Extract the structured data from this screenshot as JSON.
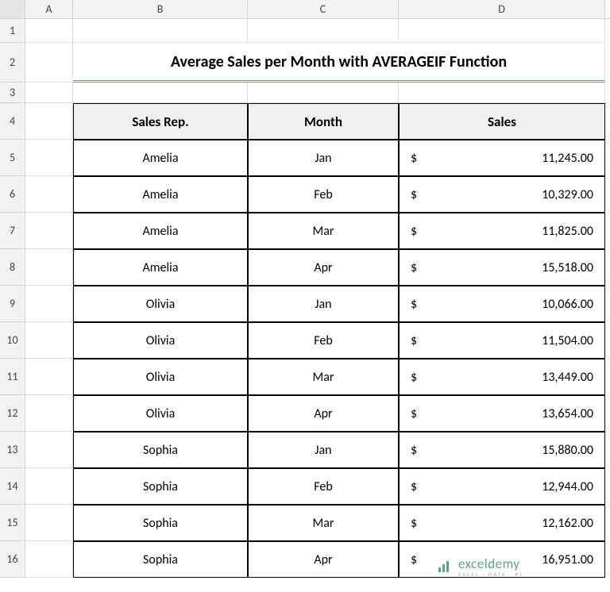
{
  "columns": [
    "A",
    "B",
    "C",
    "D"
  ],
  "title": "Average Sales per Month with AVERAGEIF Function",
  "headers": {
    "rep": "Sales Rep.",
    "month": "Month",
    "sales": "Sales"
  },
  "currency": "$",
  "rows": [
    {
      "rep": "Amelia",
      "month": "Jan",
      "sales": "11,245.00"
    },
    {
      "rep": "Amelia",
      "month": "Feb",
      "sales": "10,329.00"
    },
    {
      "rep": "Amelia",
      "month": "Mar",
      "sales": "11,825.00"
    },
    {
      "rep": "Amelia",
      "month": "Apr",
      "sales": "15,518.00"
    },
    {
      "rep": "Olivia",
      "month": "Jan",
      "sales": "10,066.00"
    },
    {
      "rep": "Olivia",
      "month": "Feb",
      "sales": "11,504.00"
    },
    {
      "rep": "Olivia",
      "month": "Mar",
      "sales": "13,449.00"
    },
    {
      "rep": "Olivia",
      "month": "Apr",
      "sales": "13,654.00"
    },
    {
      "rep": "Sophia",
      "month": "Jan",
      "sales": "15,880.00"
    },
    {
      "rep": "Sophia",
      "month": "Feb",
      "sales": "12,944.00"
    },
    {
      "rep": "Sophia",
      "month": "Mar",
      "sales": "12,162.00"
    },
    {
      "rep": "Sophia",
      "month": "Apr",
      "sales": "16,951.00"
    }
  ],
  "watermark": {
    "brand": "exceldemy",
    "tagline": "EXCEL · DATA · BI"
  }
}
